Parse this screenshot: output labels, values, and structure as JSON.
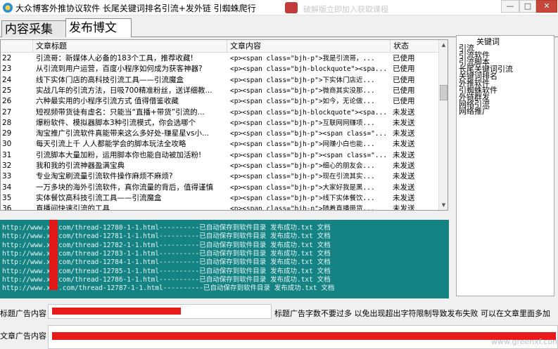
{
  "window": {
    "title": "大众博客外推协议软件 长尾关键词排名引流+发外链 引蜘蛛爬行",
    "background_window_title": "破解版立即加入获取课程"
  },
  "tabs": [
    {
      "label": "内容采集",
      "active": false
    },
    {
      "label": "发布博文",
      "active": true
    }
  ],
  "table": {
    "columns": [
      "",
      "文章标题",
      "文章内容",
      "状态"
    ],
    "rows": [
      {
        "id": "22",
        "title": "引流哥：新媒体人必备的183个工具，推荐收藏!",
        "content": "<p><span class=\"bjh-p\">我是引流哥，...",
        "status": "已使用"
      },
      {
        "id": "23",
        "title": "从引流到用户运营，百度小程序如何成为获客神器?",
        "content": "<p><span class=\"bjh-blockquote\"><spa...",
        "status": "已使用"
      },
      {
        "id": "24",
        "title": "线下实体门店的高科技引流工具——引流魔盒",
        "content": "<p><span class=\"bjh-p\">下实体门店近...",
        "status": "已使用"
      },
      {
        "id": "25",
        "title": "实战几年的引流方法，日吸700精准粉丝，送详细教...",
        "content": "<p><span class=\"bjh-p\">微商其实没那...",
        "status": "已使用"
      },
      {
        "id": "26",
        "title": "六种最实用的小程序引流方式 值得借鉴收藏",
        "content": "<p><span class=\"bjh-p\">如今，无论做...",
        "status": "已使用"
      },
      {
        "id": "27",
        "title": "短视频带货徒有虚名：只能当“直播+带货”引流的...",
        "content": "<p><span class=\"bjh-blockquote\"><spa...",
        "status": "未发送"
      },
      {
        "id": "28",
        "title": "爆粉软件、模拟器脚本3种引流模式，你会选哪个",
        "content": "<p><span class=\"bjh-p\">互联网网赚项...",
        "status": "未发送"
      },
      {
        "id": "29",
        "title": "淘宝推广引流软件真能带来这么多好处-赚星星vs小...",
        "content": "<p><span class=\"bjh-p\"><span class=\"...",
        "status": "未发送"
      },
      {
        "id": "30",
        "title": "每天引流上千 人人都能学会的脚本玩法全攻略",
        "content": "<p><span class=\"bjh-p\">网赚小白也能...",
        "status": "未发送"
      },
      {
        "id": "31",
        "title": "引流脚本大量加粉，运用脚本你也能自动被加活粉!",
        "content": "<p><span class=\"bjh-p\"><span class=\"...",
        "status": "未发送"
      },
      {
        "id": "32",
        "title": "我和我的引流神器盈满宝典",
        "content": "<p><span class=\"bjh-p\">细心的朋友会...",
        "status": "未发送"
      },
      {
        "id": "33",
        "title": "专业淘宝刷流量引流软件操作麻烦不麻烦?",
        "content": "<p><span class=\"bjh-p\">现在引流其实...",
        "status": "未发送"
      },
      {
        "id": "34",
        "title": "一万多块的海外引流软件，真你流量的背后，值得谨慎",
        "content": "<p><span class=\"bjh-p\">大家好我是黑...",
        "status": "未发送"
      },
      {
        "id": "35",
        "title": "实体餐饮高科技引流工具——引流魔盒",
        "content": "<p><span class=\"bjh-p\">线下实体餐饮...",
        "status": "未发送"
      },
      {
        "id": "36",
        "title": "直播间快速引流的工具",
        "content": "<p><span class=\"bjh-p\">随着直播带货...",
        "status": "未发送"
      }
    ]
  },
  "keywords": {
    "label": "关键词",
    "items": [
      "引流",
      "引流软件",
      "引流脚本",
      "长尾关键词引流",
      "关键词排名",
      "外推软件",
      "引蜘蛛软件",
      "外链群发",
      "网络引流",
      "网络推广"
    ]
  },
  "log": {
    "lines": [
      "http://www.x   .com/thread-12780-1-1.html----------已自动保存到软件目录 发布成功.txt 文档",
      "http://www.x   .com/thread-12781-1-1.html----------已自动保存到软件目录 发布成功.txt 文档",
      "http://www.x   .com/thread-12782-1-1.html----------已自动保存到软件目录 发布成功.txt 文档",
      "http://www.x   .com/thread-12783-1-1.html----------已自动保存到软件目录 发布成功.txt 文档",
      "http://www.x   .com/thread-12784-1-1.html----------已自动保存到软件目录 发布成功.txt 文档",
      "http://www.x   .com/thread-12785-1-1.html----------已自动保存到软件目录 发布成功.txt 文档",
      "http://www.x   .com/thread-12786-1-1.html----------已自动保存到软件目录 发布成功.txt 文档",
      "http://www.x   f.com/thread-12787-1-1.html----------已自动保存到软件目录 发布成功.txt 文档"
    ]
  },
  "ad_fields": {
    "title_ad_label": "标题广告内容",
    "title_ad_hint": "标题广告字数不要过多 以免出现超出字符限制导致发布失败 可以在文章里面多加",
    "article_ad_label": "文章广告内容"
  },
  "watermark": "www.greenxf.com",
  "colors": {
    "log_background": "#158383",
    "redaction": "#e01818"
  },
  "icons": {
    "app": "app-logo-icon",
    "minimize": "minimize-icon",
    "maximize": "maximize-icon",
    "close": "close-icon"
  }
}
